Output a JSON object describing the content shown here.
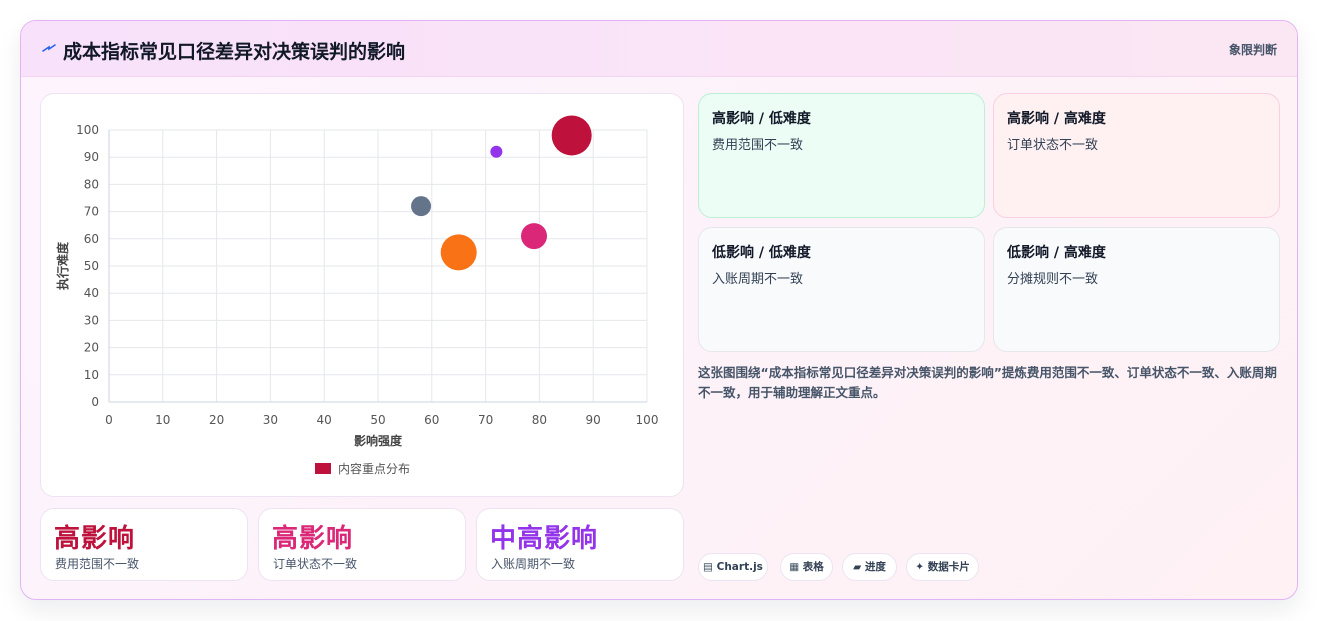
{
  "header": {
    "title": "成本指标常见口径差异对决策误判的影响",
    "badge": "象限判断"
  },
  "chart_data": {
    "type": "bubble",
    "xlabel": "影响强度",
    "ylabel": "执行难度",
    "xlim": [
      0,
      100
    ],
    "ylim": [
      0,
      100
    ],
    "xticks": [
      0,
      10,
      20,
      30,
      40,
      50,
      60,
      70,
      80,
      90,
      100
    ],
    "yticks": [
      0,
      10,
      20,
      30,
      40,
      50,
      60,
      70,
      80,
      90,
      100
    ],
    "grid": true,
    "legend_position": "bottom",
    "series": [
      {
        "name": "内容重点分布",
        "points": [
          {
            "x": 86,
            "y": 98,
            "r": 20,
            "color": "#be123c"
          },
          {
            "x": 72,
            "y": 92,
            "r": 6,
            "color": "#9333ea"
          },
          {
            "x": 58,
            "y": 72,
            "r": 10,
            "color": "#64748b"
          },
          {
            "x": 79,
            "y": 61,
            "r": 13,
            "color": "#db2777"
          },
          {
            "x": 65,
            "y": 55,
            "r": 18,
            "color": "#f97316"
          }
        ]
      }
    ],
    "legend_color": "#be123c"
  },
  "stats": [
    {
      "value": "高影响",
      "label": "费用范围不一致",
      "color": "#be123c"
    },
    {
      "value": "高影响",
      "label": "订单状态不一致",
      "color": "#db2777"
    },
    {
      "value": "中高影响",
      "label": "入账周期不一致",
      "color": "#9333ea"
    }
  ],
  "quadrants": [
    {
      "title": "高影响 / 低难度",
      "item": "费用范围不一致",
      "bg": "#ecfdf5",
      "border": "#bbf0d4"
    },
    {
      "title": "高影响 / 高难度",
      "item": "订单状态不一致",
      "bg": "#fff1f2",
      "border": "#fbcfe0"
    },
    {
      "title": "低影响 / 低难度",
      "item": "入账周期不一致",
      "bg": "#f8fafc",
      "border": "#e5e7eb"
    },
    {
      "title": "低影响 / 高难度",
      "item": "分摊规则不一致",
      "bg": "#f8fafc",
      "border": "#e5e7eb"
    }
  ],
  "description": "这张图围绕“成本指标常见口径差异对决策误判的影响”提炼费用范围不一致、订单状态不一致、入账周期不一致，用于辅助理解正文重点。",
  "tags": [
    {
      "label": "Chart.js",
      "icon": "chart-icon"
    },
    {
      "label": "表格",
      "icon": "table-icon"
    },
    {
      "label": "进度",
      "icon": "folder-icon"
    },
    {
      "label": "数据卡片",
      "icon": "sparkle-icon"
    }
  ],
  "colors": {
    "accent": "#be123c",
    "secondary": "#9333ea"
  }
}
